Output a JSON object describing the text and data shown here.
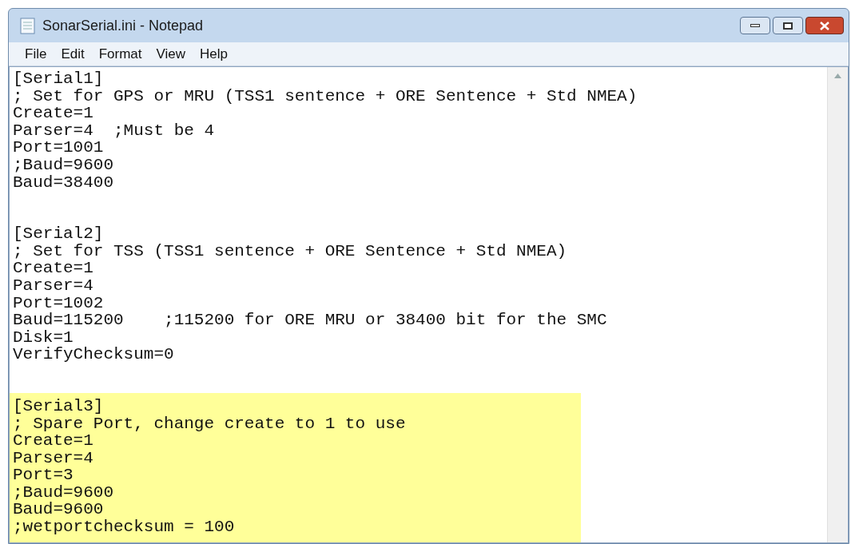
{
  "window": {
    "title": "SonarSerial.ini - Notepad"
  },
  "menu": [
    {
      "label": "File"
    },
    {
      "label": "Edit"
    },
    {
      "label": "Format"
    },
    {
      "label": "View"
    },
    {
      "label": "Help"
    }
  ],
  "editor": {
    "sections": [
      {
        "highlighted": false,
        "lines": [
          "[Serial1]",
          "; Set for GPS or MRU (TSS1 sentence + ORE Sentence + Std NMEA)",
          "Create=1",
          "Parser=4  ;Must be 4",
          "Port=1001",
          ";Baud=9600",
          "Baud=38400"
        ]
      },
      {
        "highlighted": false,
        "lines": [
          "[Serial2]",
          "; Set for TSS (TSS1 sentence + ORE Sentence + Std NMEA)",
          "Create=1",
          "Parser=4",
          "Port=1002",
          "Baud=115200    ;115200 for ORE MRU or 38400 bit for the SMC",
          "Disk=1",
          "VerifyChecksum=0"
        ]
      },
      {
        "highlighted": true,
        "lines": [
          "[Serial3]",
          "; Spare Port, change create to 1 to use",
          "Create=1",
          "Parser=4",
          "Port=3",
          ";Baud=9600",
          "Baud=9600",
          ";wetportchecksum = 100"
        ]
      }
    ]
  }
}
